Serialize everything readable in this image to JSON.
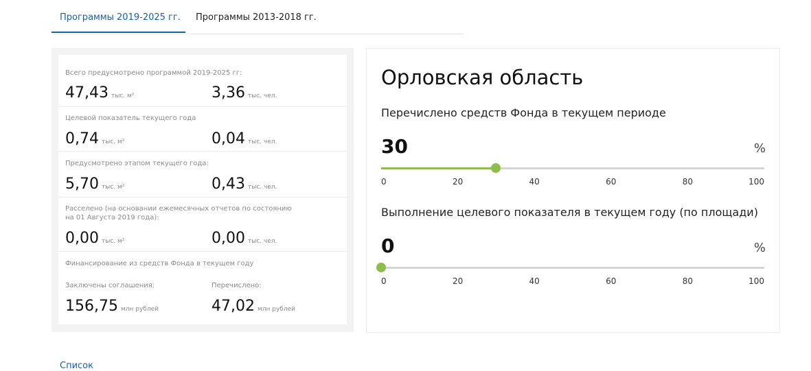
{
  "tabs": [
    {
      "label": "Программы 2019-2025 гг.",
      "active": true
    },
    {
      "label": "Программы 2013-2018 гг.",
      "active": false
    }
  ],
  "stats": {
    "total": {
      "label": "Всего предусмотрено программой 2019-2025 гг:",
      "area": "47,43",
      "area_unit": "тыс. м²",
      "people": "3,36",
      "people_unit": "тыс. чел."
    },
    "target": {
      "label": "Целевой показатель текущего года",
      "area": "0,74",
      "area_unit": "тыс. м²",
      "people": "0,04",
      "people_unit": "тыс. чел."
    },
    "stage": {
      "label": "Предусмотрено этапом текущего года:",
      "area": "5,70",
      "area_unit": "тыс. м²",
      "people": "0,43",
      "people_unit": "тыс. чел."
    },
    "resettled": {
      "label": "Расселено (на основании ежемесячных отчетов по состоянию на 01 Августа 2019 года):",
      "area": "0,00",
      "area_unit": "тыс. м²",
      "people": "0,00",
      "people_unit": "тыс. чел."
    },
    "financing": {
      "label": "Финансирование из средств Фонда в текущем году",
      "agreements_label": "Заключены соглашения:",
      "agreements": "156,75",
      "agreements_unit": "млн рублей",
      "transferred_label": "Перечислено:",
      "transferred": "47,02",
      "transferred_unit": "млн рублей"
    }
  },
  "region": {
    "title": "Орловская область",
    "metric1": {
      "label": "Перечислено средств Фонда в текущем периоде",
      "value": "30",
      "value_num": 30,
      "unit": "%"
    },
    "metric2": {
      "label": "Выполнение целевого показателя в текущем году (по площади)",
      "value": "0",
      "value_num": 0,
      "unit": "%"
    },
    "ticks": [
      "0",
      "20",
      "40",
      "60",
      "80",
      "100"
    ],
    "slider_color": "#8ebd4e"
  },
  "footer": {
    "list_link": "Список"
  },
  "colors": {
    "accent": "#1b5fa0"
  }
}
